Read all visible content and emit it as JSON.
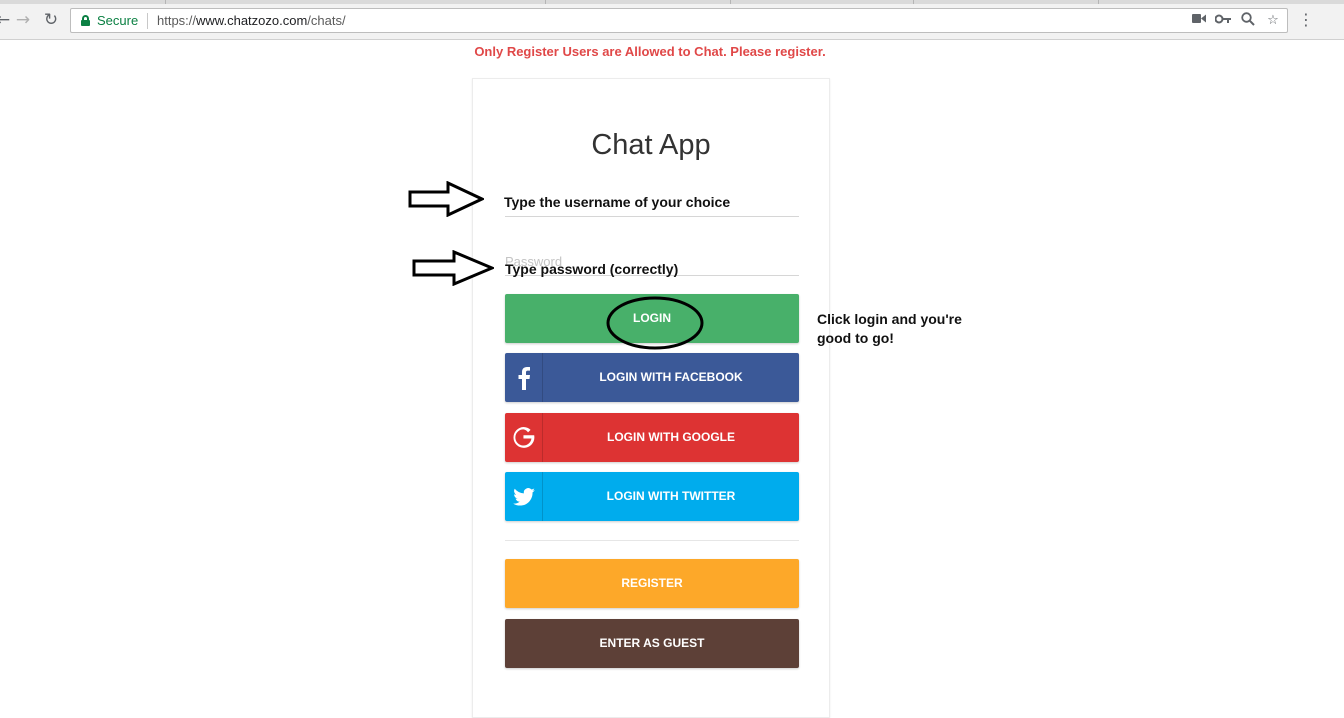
{
  "browser": {
    "secure_label": "Secure",
    "url_scheme": "https://",
    "url_host": "www.chatzozo.com",
    "url_path": "/chats/",
    "icons": [
      "back-icon",
      "forward-icon",
      "reload-icon",
      "lock-icon",
      "camera-icon",
      "key-icon",
      "zoom-icon",
      "star-icon",
      "menu-icon"
    ]
  },
  "page": {
    "notice": "Only Register Users are Allowed to Chat. Please register.",
    "app_title": "Chat App",
    "password_placeholder": "Password"
  },
  "buttons": {
    "login": "LOGIN",
    "facebook": "LOGIN WITH FACEBOOK",
    "google": "LOGIN WITH GOOGLE",
    "twitter": "LOGIN WITH TWITTER",
    "register": "REGISTER",
    "guest": "ENTER AS GUEST"
  },
  "annotations": {
    "username_hint": "Type the username of your choice",
    "password_hint": "Type password (correctly)",
    "login_hint": "Click login and you're good to go!"
  },
  "colors": {
    "notice": "#e04848",
    "login": "#48b06a",
    "facebook": "#3b5998",
    "google": "#dd3333",
    "twitter": "#00aced",
    "register": "#fda829",
    "guest": "#5d4037"
  }
}
